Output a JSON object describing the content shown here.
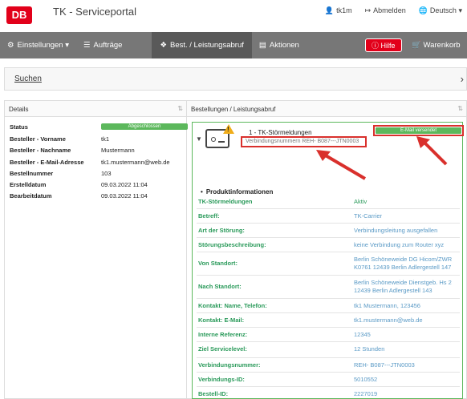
{
  "header": {
    "logo": "DB",
    "title": "TK - Serviceportal",
    "user": "tk1m",
    "logout": "Abmelden",
    "language": "Deutsch"
  },
  "nav": {
    "settings": "Einstellungen",
    "orders": "Aufträge",
    "active": "Best. / Leistungsabruf",
    "actions": "Aktionen",
    "help": "Hilfe",
    "cart": "Warenkorb"
  },
  "search": {
    "label": "Suchen"
  },
  "details": {
    "title": "Details",
    "status_label": "Status",
    "status_badge": "Abgeschlossen",
    "rows": [
      {
        "label": "Besteller - Vorname",
        "value": "tk1"
      },
      {
        "label": "Besteller - Nachname",
        "value": "Mustermann"
      },
      {
        "label": "Besteller - E-Mail-Adresse",
        "value": "tk1.mustermann@web.de"
      },
      {
        "label": "Bestellnummer",
        "value": "103"
      },
      {
        "label": "Erstelldatum",
        "value": "09.03.2022 11:04"
      },
      {
        "label": "Bearbeitdatum",
        "value": "09.03.2022 11:04"
      }
    ]
  },
  "orders": {
    "title": "Bestellungen / Leistungsabruf",
    "item_title": "1 - TK-Störmeldungen",
    "connection_numbers": "Verbindungsnummern REH- B087---JTN0003",
    "email_badge": "E-Mail versendet",
    "section_title": "Produktinformationen",
    "product_name": "TK-Störmeldungen",
    "product_state": "Aktiv",
    "rows": [
      {
        "label": "Betreff:",
        "value": "TK-Carrier"
      },
      {
        "label": "Art der Störung:",
        "value": "Verbindungsleitung ausgefallen"
      },
      {
        "label": "Störungsbeschreibung:",
        "value": "keine Verbindung zum Router xyz"
      },
      {
        "label": "Von Standort:",
        "value1": "Berlin Schöneweide DG Hicom/ZWR",
        "value2": "K0761 12439 Berlin Adlergestell 147"
      },
      {
        "label": "Nach Standort:",
        "value1": "Berlin Schöneweide Dienstgeb. Hs 2",
        "value2": "12439 Berlin Adlergestell 143"
      },
      {
        "label": "Kontakt: Name, Telefon:",
        "value": "tk1 Mustermann, 123456"
      },
      {
        "label": "Kontakt: E-Mail:",
        "value": "tk1.mustermann@web.de"
      },
      {
        "label": "Interne Referenz:",
        "value": "12345"
      },
      {
        "label": "Ziel Servicelevel:",
        "value": "12 Stunden"
      },
      {
        "label": "Verbindungsnummer:",
        "value": "REH- B087---JTN0003"
      },
      {
        "label": "Verbindungs-ID:",
        "value": "5010552"
      },
      {
        "label": "Bestell-ID:",
        "value": "2227019"
      }
    ]
  },
  "colors": {
    "brand": "#e2001a",
    "nav": "#777777",
    "active_nav": "#595959",
    "success": "#5cb85c",
    "highlight": "#d9302c"
  }
}
